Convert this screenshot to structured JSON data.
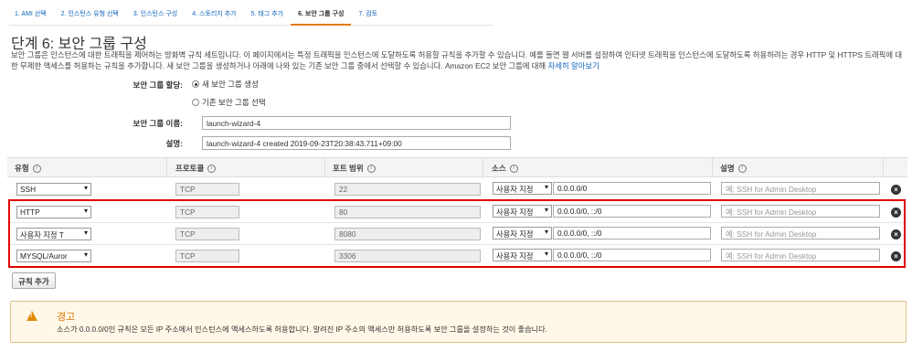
{
  "wizard": {
    "tabs": [
      "1. AMI 선택",
      "2. 인스턴스 유형 선택",
      "3. 인스턴스 구성",
      "4. 스토리지 추가",
      "5. 태그 추가",
      "6. 보안 그룹 구성",
      "7. 검토"
    ],
    "active_index": 5
  },
  "page": {
    "title": "단계 6: 보안 그룹 구성",
    "description": "보안 그룹은 인스턴스에 대한 트래픽을 제어하는 방화벽 규칙 세트입니다. 이 페이지에서는 특정 트래픽을 인스턴스에 도달하도록 허용할 규칙을 추가할 수 있습니다. 예를 들면 웹 서버를 설정하여 인터넷 트래픽을 인스턴스에 도달하도록 허용하려는 경우 HTTP 및 HTTPS 트래픽에 대한 무제한 액세스를 허용하는 규칙을 추가합니다. 새 보안 그룹을 생성하거나 아래에 나와 있는 기존 보안 그룹 중에서 선택할 수 있습니다. Amazon EC2 보안 그룹에 대해",
    "learn_more": "자세히 알아보기"
  },
  "form": {
    "assign_label": "보안 그룹 할당:",
    "option_new": "새 보안 그룹 생성",
    "option_existing": "기존 보안 그룹 선택",
    "name_label": "보안 그룹 이름:",
    "name_value": "launch-wizard-4",
    "desc_label": "설명:",
    "desc_value": "launch-wizard-4 created 2019-09-23T20:38:43.711+09:00"
  },
  "table": {
    "headers": {
      "type": "유형",
      "protocol": "프로토콜",
      "port": "포트 범위",
      "source": "소스",
      "description": "설명"
    },
    "rows": [
      {
        "type": "SSH",
        "protocol": "TCP",
        "port": "22",
        "source_mode": "사용자 지정",
        "source": "0.0.0.0/0",
        "desc_placeholder": "예: SSH for Admin Desktop"
      },
      {
        "type": "HTTP",
        "protocol": "TCP",
        "port": "80",
        "source_mode": "사용자 지정",
        "source": "0.0.0.0/0, ::/0",
        "desc_placeholder": "예: SSH for Admin Desktop"
      },
      {
        "type": "사용자 지정 T",
        "protocol": "TCP",
        "port": "8080",
        "source_mode": "사용자 지정",
        "source": "0.0.0.0/0, ::/0",
        "desc_placeholder": "예: SSH for Admin Desktop"
      },
      {
        "type": "MYSQL/Auror",
        "protocol": "TCP",
        "port": "3306",
        "source_mode": "사용자 지정",
        "source": "0.0.0.0/0, ::/0",
        "desc_placeholder": "예: SSH for Admin Desktop"
      }
    ],
    "add_rule": "규칙 추가"
  },
  "warning": {
    "title": "경고",
    "text": "소스가 0.0.0.0/0인 규칙은 모든 IP 주소에서 인스턴스에 액세스하도록 허용합니다. 알려진 IP 주소의 액세스만 허용하도록 보안 그룹을 설정하는 것이 좋습니다.",
    "icon": "warning-icon"
  },
  "colors": {
    "link": "#1166bb",
    "highlight": "#e00000",
    "warning": "#dd7700",
    "active_tab": "#e47911"
  }
}
